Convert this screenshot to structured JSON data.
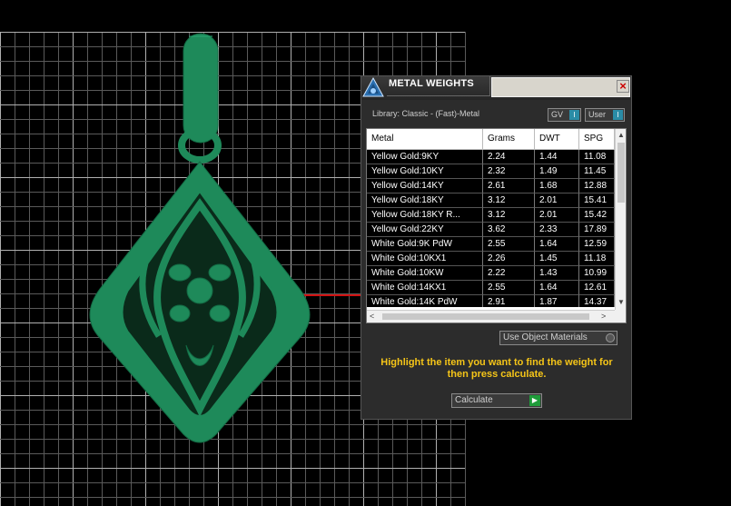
{
  "dialog": {
    "title": "METAL WEIGHTS",
    "close_glyph": "×",
    "library_label": "Library: Classic - (Fast)-Metal",
    "toggle_gv": "GV",
    "toggle_user": "User",
    "toggle_knob": "I",
    "table": {
      "headers": [
        "Metal",
        "Grams",
        "DWT",
        "SPG"
      ],
      "rows": [
        [
          "Yellow Gold:9KY",
          "2.24",
          "1.44",
          "11.08"
        ],
        [
          "Yellow Gold:10KY",
          "2.32",
          "1.49",
          "11.45"
        ],
        [
          "Yellow Gold:14KY",
          "2.61",
          "1.68",
          "12.88"
        ],
        [
          "Yellow Gold:18KY",
          "3.12",
          "2.01",
          "15.41"
        ],
        [
          "Yellow Gold:18KY R...",
          "3.12",
          "2.01",
          "15.42"
        ],
        [
          "Yellow Gold:22KY",
          "3.62",
          "2.33",
          "17.89"
        ],
        [
          "White Gold:9K PdW",
          "2.55",
          "1.64",
          "12.59"
        ],
        [
          "White Gold:10KX1",
          "2.26",
          "1.45",
          "11.18"
        ],
        [
          "White Gold:10KW",
          "2.22",
          "1.43",
          "10.99"
        ],
        [
          "White Gold:14KX1",
          "2.55",
          "1.64",
          "12.61"
        ],
        [
          "White Gold:14K PdW",
          "2.91",
          "1.87",
          "14.37"
        ]
      ]
    },
    "use_object_materials": "Use Object Materials",
    "hint": "Highlight the item you want to find the weight for then press calculate.",
    "calculate_label": "Calculate",
    "calculate_glyph": "▶"
  },
  "colors": {
    "model_green": "#1e8a5a",
    "grid_line": "#8a8a8a",
    "hint_yellow": "#f5c518",
    "axis_red": "#d01010"
  },
  "icons": {
    "logo": "app-logo-icon",
    "close": "close-icon",
    "run": "play-icon"
  }
}
